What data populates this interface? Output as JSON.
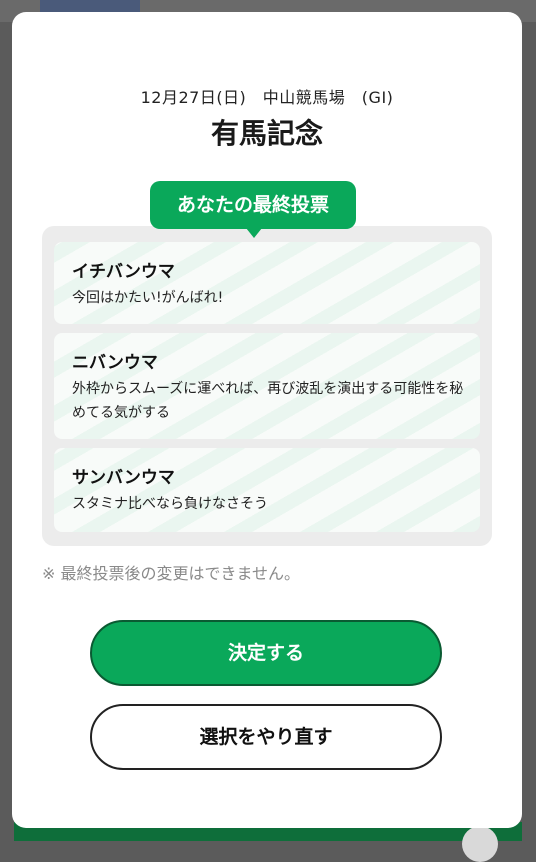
{
  "race": {
    "info": "12月27日(日)　中山競馬場　(GI)",
    "name": "有馬記念"
  },
  "vote_label": "あなたの最終投票",
  "picks": [
    {
      "name": "イチバンウマ",
      "comment": "今回はかたい!がんばれ!"
    },
    {
      "name": "ニバンウマ",
      "comment": "外枠からスムーズに運べれば、再び波乱を演出する可能性を秘めてる気がする"
    },
    {
      "name": "サンバンウマ",
      "comment": "スタミナ比べなら負けなさそう"
    }
  ],
  "note": "※ 最終投票後の変更はできません。",
  "buttons": {
    "confirm": "決定する",
    "redo": "選択をやり直す"
  },
  "colors": {
    "accent": "#0aa85a",
    "note": "#8a8a8a"
  }
}
